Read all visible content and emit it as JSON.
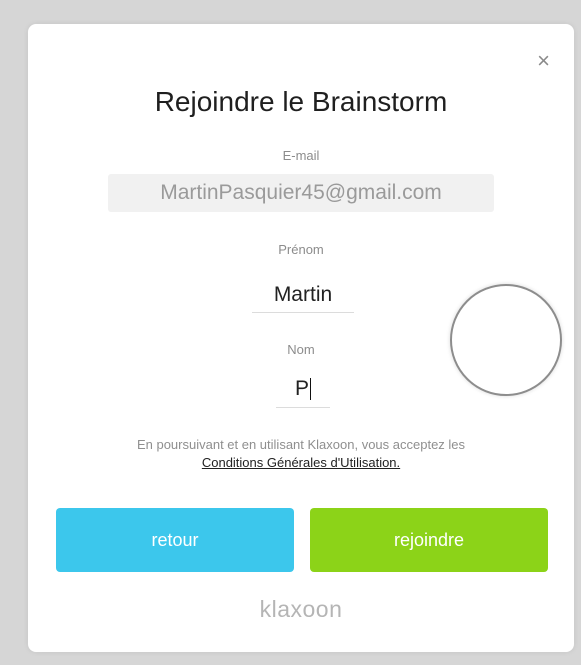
{
  "dialog": {
    "title": "Rejoindre le Brainstorm",
    "close_label": "×"
  },
  "form": {
    "email": {
      "label": "E-mail",
      "value": "MartinPasquier45@gmail.com"
    },
    "first_name": {
      "label": "Prénom",
      "value": "Martin"
    },
    "last_name": {
      "label": "Nom",
      "value": "P"
    }
  },
  "terms": {
    "text": "En poursuivant et en utilisant Klaxoon, vous acceptez les",
    "link_label": "Conditions Générales d'Utilisation."
  },
  "buttons": {
    "back_label": "retour",
    "join_label": "rejoindre"
  },
  "brand": {
    "name": "klaxoon"
  },
  "colors": {
    "back_button": "#3cc7ec",
    "join_button": "#8cd318"
  }
}
